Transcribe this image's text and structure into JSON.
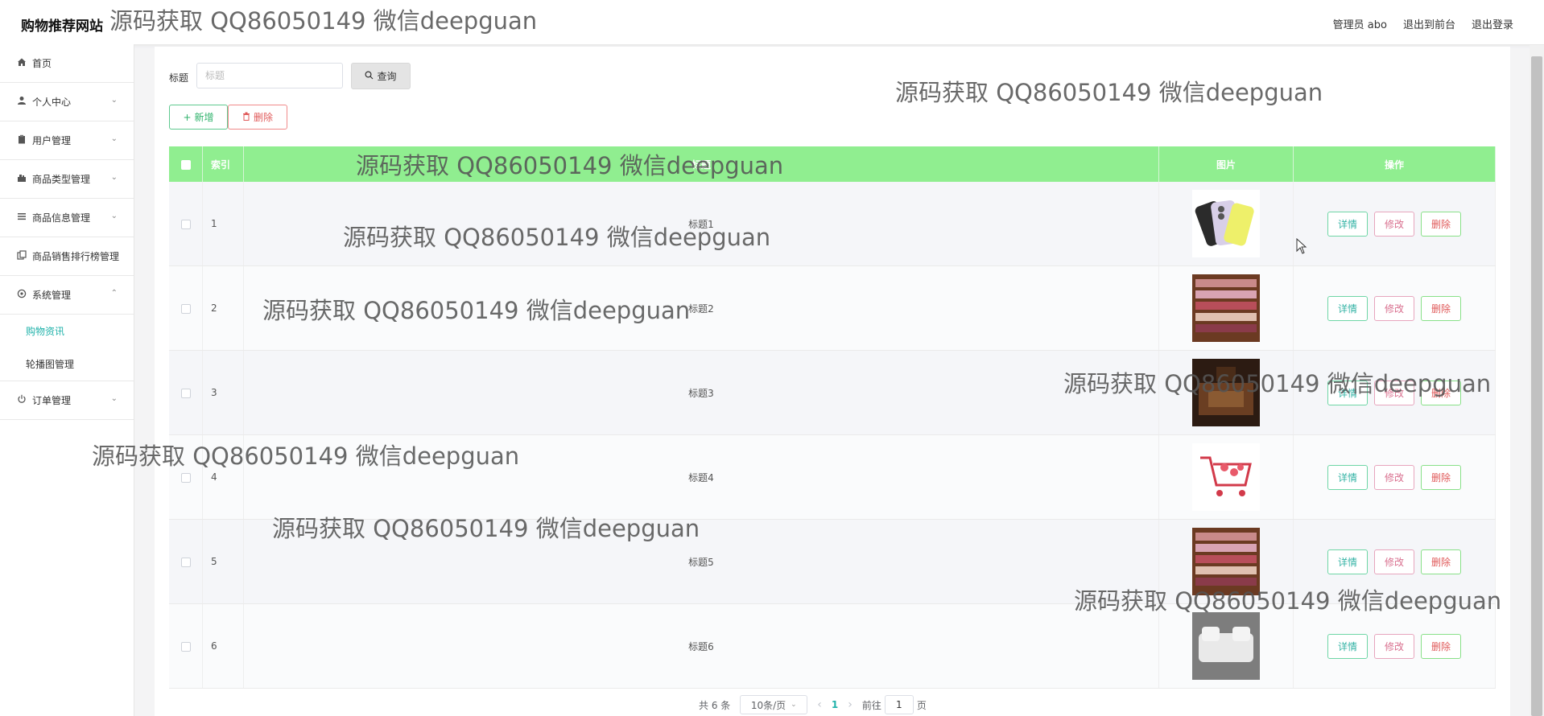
{
  "header": {
    "brand": "购物推荐网站",
    "links": [
      "管理员 abo",
      "退出到前台",
      "退出登录"
    ]
  },
  "sidebar": {
    "items": [
      {
        "label": "首页",
        "icon": "home-icon"
      },
      {
        "label": "个人中心",
        "icon": "user-icon"
      },
      {
        "label": "用户管理",
        "icon": "clipboard-icon"
      },
      {
        "label": "商品类型管理",
        "icon": "category-icon"
      },
      {
        "label": "商品信息管理",
        "icon": "list-icon"
      },
      {
        "label": "商品销售排行榜管理",
        "icon": "copy-icon"
      },
      {
        "label": "系统管理",
        "icon": "settings-icon"
      },
      {
        "label": "订单管理",
        "icon": "power-icon"
      }
    ],
    "sub_items": [
      "购物资讯",
      "轮播图管理"
    ]
  },
  "search": {
    "label": "标题",
    "placeholder": "标题",
    "button": "查询"
  },
  "toolbar": {
    "add_label": "新增",
    "delete_label": "删除"
  },
  "table": {
    "headers": [
      "索引",
      "标题",
      "图片",
      "操作"
    ],
    "rows": [
      {
        "index": "1",
        "title": "标题1",
        "image": "phone"
      },
      {
        "index": "2",
        "title": "标题2",
        "image": "shoe-shelf"
      },
      {
        "index": "3",
        "title": "标题3",
        "image": "furniture"
      },
      {
        "index": "4",
        "title": "标题4",
        "image": "shopping-cart"
      },
      {
        "index": "5",
        "title": "标题5",
        "image": "shoe-shelf"
      },
      {
        "index": "6",
        "title": "标题6",
        "image": "sofa"
      }
    ],
    "actions": {
      "detail": "详情",
      "edit": "修改",
      "delete": "删除"
    }
  },
  "pagination": {
    "total": "共 6 条",
    "page_size": "10条/页",
    "current_page": "1",
    "goto_prefix": "前往",
    "goto_value": "1",
    "goto_suffix": "页"
  },
  "watermark": "源码获取 QQ86050149 微信deepguan",
  "colors": {
    "table_header": "#90ee90",
    "accent": "#20b2aa",
    "danger": "#e05a5a"
  }
}
